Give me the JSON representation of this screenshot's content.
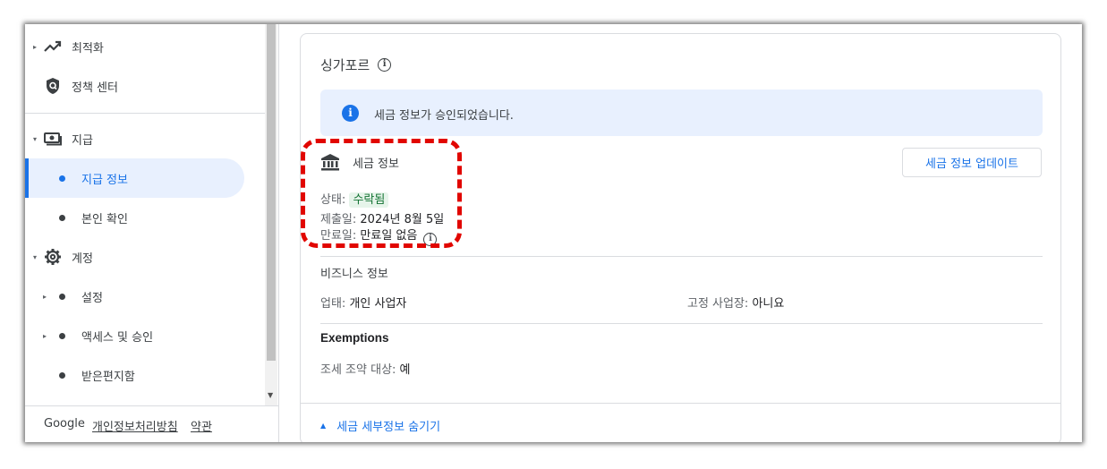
{
  "sidebar": {
    "items": [
      {
        "label": "최적화",
        "icon": "trending-up-icon"
      },
      {
        "label": "정책 센터",
        "icon": "shield-icon"
      },
      {
        "label": "지급",
        "icon": "payments-icon"
      },
      {
        "label": "지급 정보"
      },
      {
        "label": "본인 확인"
      },
      {
        "label": "계정",
        "icon": "gear-icon"
      },
      {
        "label": "설정"
      },
      {
        "label": "액세스 및 승인"
      },
      {
        "label": "받은편지함"
      }
    ],
    "footer": {
      "brand": "Google",
      "privacy": "개인정보처리방침",
      "terms": "약관"
    }
  },
  "card": {
    "title": "싱가포르",
    "banner": "세금 정보가 승인되었습니다.",
    "tax_info": {
      "heading": "세금 정보",
      "status_label": "상태:",
      "status_value": "수락됨",
      "submitted_label": "제출일:",
      "submitted_value": "2024년 8월 5일",
      "expiry_label": "만료일:",
      "expiry_value": "만료일 없음"
    },
    "update_button": "세금 정보 업데이트",
    "business": {
      "title": "비즈니스 정보",
      "type_label": "업태:",
      "type_value": "개인 사업자",
      "fixed_label": "고정 사업장:",
      "fixed_value": "아니요"
    },
    "exemptions": {
      "title": "Exemptions",
      "treaty_label": "조세 조약 대상:",
      "treaty_value": "예"
    },
    "hide_details": "세금 세부정보 숨기기"
  },
  "colors": {
    "accent": "#1a73e8",
    "banner_bg": "#e8f0fe",
    "accepted_bg": "#e6f4ea",
    "accepted_text": "#137333",
    "highlight": "#e10600"
  }
}
